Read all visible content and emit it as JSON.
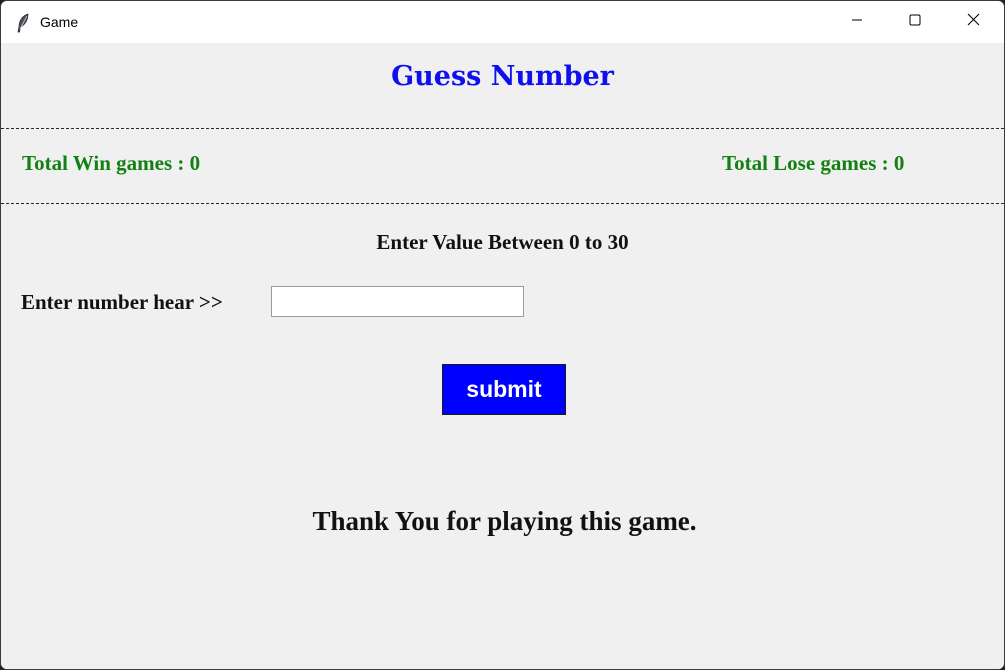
{
  "window": {
    "title": "Game",
    "icon": "feather-icon",
    "controls": [
      "minimize-icon",
      "maximize-icon",
      "close-icon"
    ]
  },
  "game": {
    "heading": "Guess Number",
    "divider": "-----------------------------------------------------------------------------------------------------------------------------------------------------------------------------------------------",
    "win_label": "Total Win games : 0",
    "lose_label": "Total Lose games : 0",
    "instruction": "Enter Value Between 0 to 30",
    "entry_label": "Enter number hear  >>",
    "entry_value": "",
    "submit_label": "submit",
    "footer": "Thank You for playing this game."
  },
  "colors": {
    "heading": "#1010ee",
    "stats": "#128012",
    "button_bg": "#0000ff",
    "button_text": "#ffffff",
    "background": "#f0f0f0"
  }
}
